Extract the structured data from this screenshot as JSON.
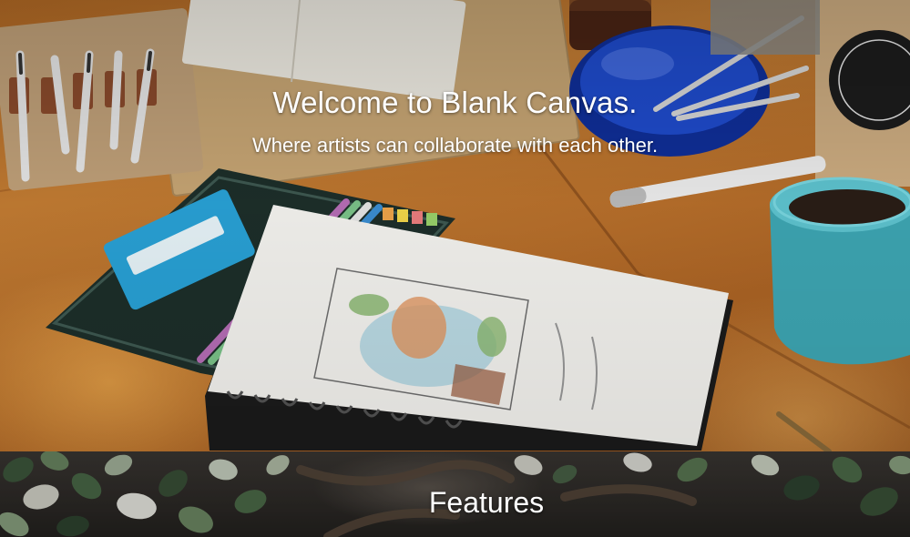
{
  "hero": {
    "title": "Welcome to Blank Canvas.",
    "subtitle": "Where artists can collaborate with each other.",
    "background_image": "artist-desk-photo"
  },
  "features": {
    "title": "Features",
    "background_image": "ivy-leaves-photo"
  },
  "colors": {
    "text": "#ffffff",
    "table_wood": "#b9702b",
    "features_bg": "#2e2b28"
  }
}
